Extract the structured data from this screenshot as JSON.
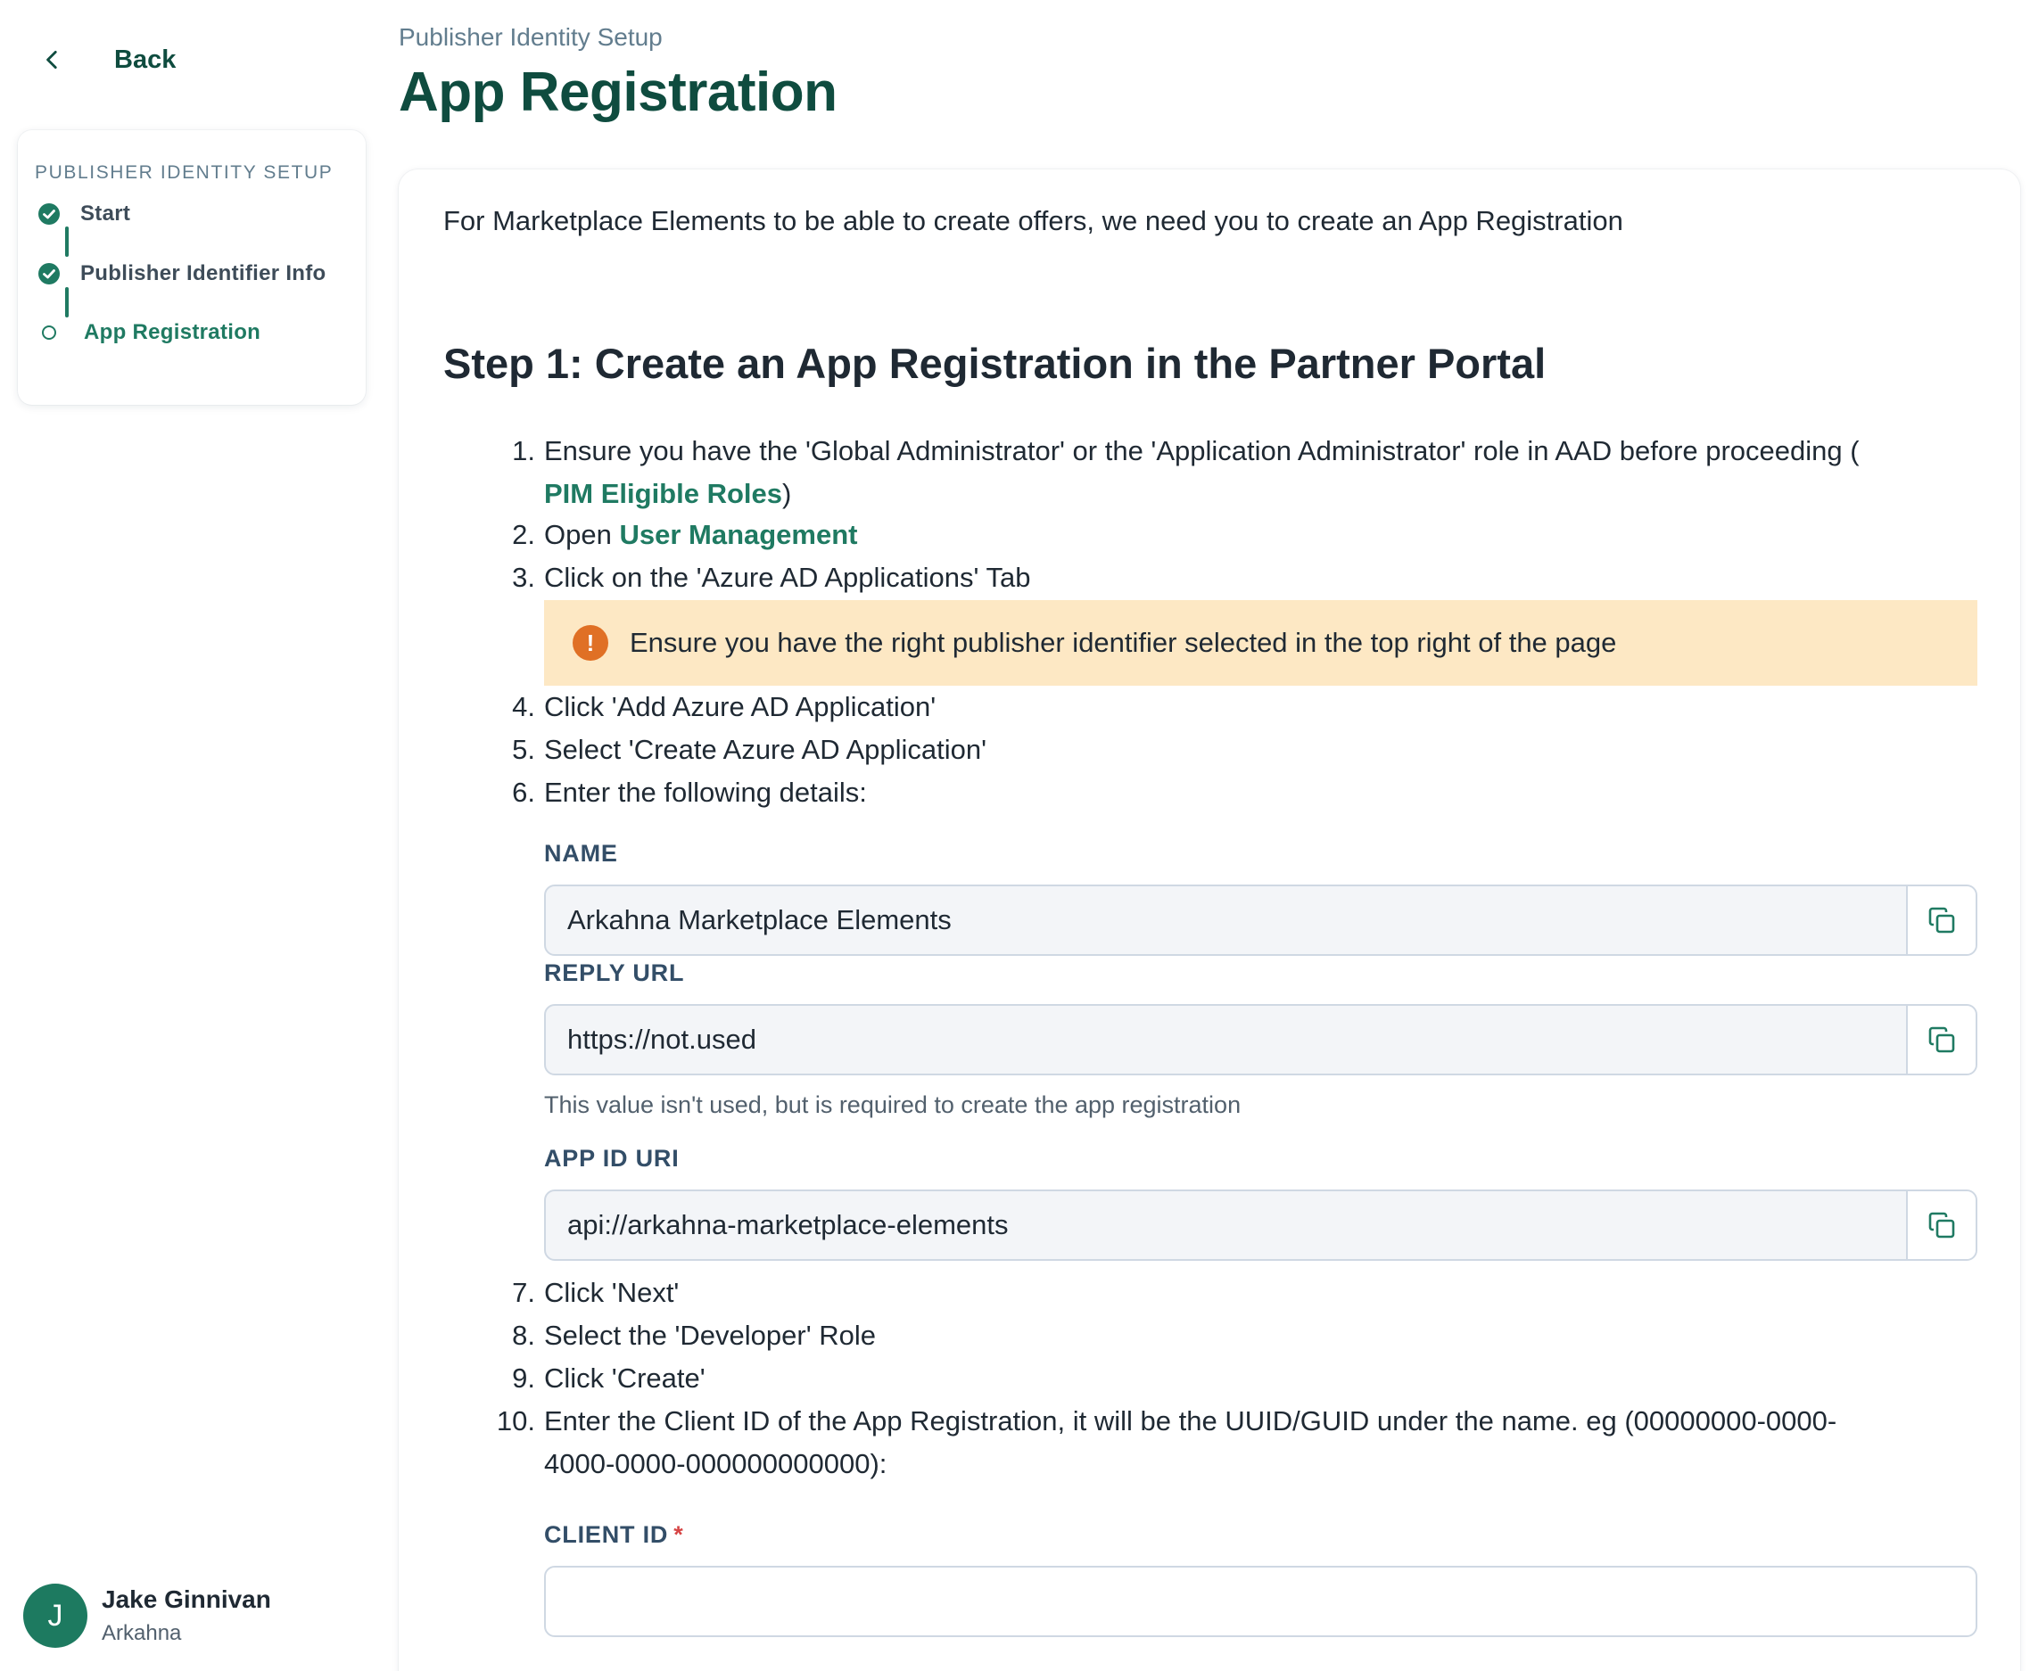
{
  "sidebar": {
    "back_label": "Back",
    "steps_heading": "PUBLISHER IDENTITY SETUP",
    "steps": [
      {
        "label": "Start",
        "state": "complete"
      },
      {
        "label": "Publisher Identifier Info",
        "state": "complete"
      },
      {
        "label": "App Registration",
        "state": "current"
      }
    ],
    "user": {
      "initial": "J",
      "name": "Jake Ginnivan",
      "org": "Arkahna"
    }
  },
  "header": {
    "breadcrumb": "Publisher Identity Setup",
    "title": "App Registration"
  },
  "main": {
    "intro": "For Marketplace Elements to be able to create offers, we need you to create an App Registration",
    "step_title": "Step 1: Create an App Registration in the Partner Portal",
    "item1_pre": "Ensure you have the 'Global Administrator' or the 'Application Administrator' role in AAD before proceeding (",
    "item1_link": "PIM Eligible Roles",
    "item1_post": ")",
    "item2_pre": "Open ",
    "item2_link": "User Management",
    "item3": "Click on the 'Azure AD Applications' Tab",
    "callout": "Ensure you have the right publisher identifier selected in the top right of the page",
    "item4": "Click 'Add Azure AD Application'",
    "item5": "Select 'Create Azure AD Application'",
    "item6": "Enter the following details:",
    "fields": {
      "name_label": "NAME",
      "name_value": "Arkahna Marketplace Elements",
      "reply_label": "REPLY URL",
      "reply_value": "https://not.used",
      "reply_help": "This value isn't used, but is required to create the app registration",
      "appid_label": "APP ID URI",
      "appid_value": "api://arkahna-marketplace-elements",
      "client_label": "CLIENT ID",
      "client_required": "*",
      "client_value": ""
    },
    "item7": "Click 'Next'",
    "item8": "Select the 'Developer' Role",
    "item9": "Click 'Create'",
    "item10_line1": "Enter the Client ID of the App Registration, it will be the UUID/GUID under the name. eg (00000000-0000-",
    "item10_line2": "4000-0000-000000000000):",
    "numbers": [
      "1.",
      "2.",
      "3.",
      "4.",
      "5.",
      "6.",
      "7.",
      "8.",
      "9.",
      "10."
    ]
  },
  "colors": {
    "brand": "#0f4c3f",
    "accent": "#1f7a62",
    "warning_bg": "#fde8c4",
    "warning_icon": "#e07025"
  }
}
